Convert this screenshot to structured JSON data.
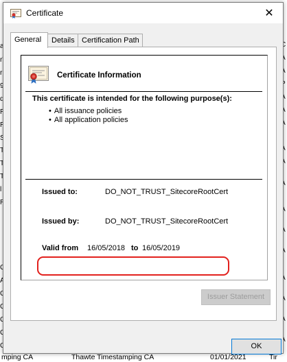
{
  "window": {
    "title": "Certificate",
    "close_glyph": "✕"
  },
  "tabs": [
    {
      "label": "General",
      "active": true
    },
    {
      "label": "Details",
      "active": false
    },
    {
      "label": "Certification Path",
      "active": false
    }
  ],
  "info": {
    "title": "Certificate Information",
    "purpose_heading": "This certificate is intended for the following purpose(s):",
    "purposes": [
      "All issuance policies",
      "All application policies"
    ],
    "issued_to_label": "Issued to:",
    "issued_to_value": "DO_NOT_TRUST_SitecoreRootCert",
    "issued_by_label": "Issued by:",
    "issued_by_value": "DO_NOT_TRUST_SitecoreRootCert",
    "valid_from_label": "Valid from",
    "valid_from_value": "16/05/2018",
    "valid_to_label": "to",
    "valid_to_value": "16/05/2019"
  },
  "buttons": {
    "issuer_statement": "Issuer Statement",
    "ok": "OK"
  },
  "background": {
    "left_fragments": [
      "a",
      "rT",
      "ri",
      "99",
      "d",
      "R",
      "R",
      "Si",
      "T",
      "T",
      "Ti",
      "l",
      "R",
      "C",
      "A",
      "C",
      "C",
      "C",
      "C",
      "C",
      "C",
      "C",
      "C"
    ],
    "right_fragments": [
      "C",
      "A",
      "A",
      "P",
      "A",
      "A",
      "A",
      "A",
      "A",
      "A",
      "A",
      "A",
      "A",
      "A",
      "A",
      "A",
      "A"
    ],
    "bottom_row": [
      "mping CA",
      "Thawte Timestamping CA",
      "01/01/2021",
      "Tir"
    ]
  },
  "colors": {
    "highlight": "#e2201c",
    "ok_border": "#0078d7",
    "dialog_bg": "#f0f0f0"
  }
}
